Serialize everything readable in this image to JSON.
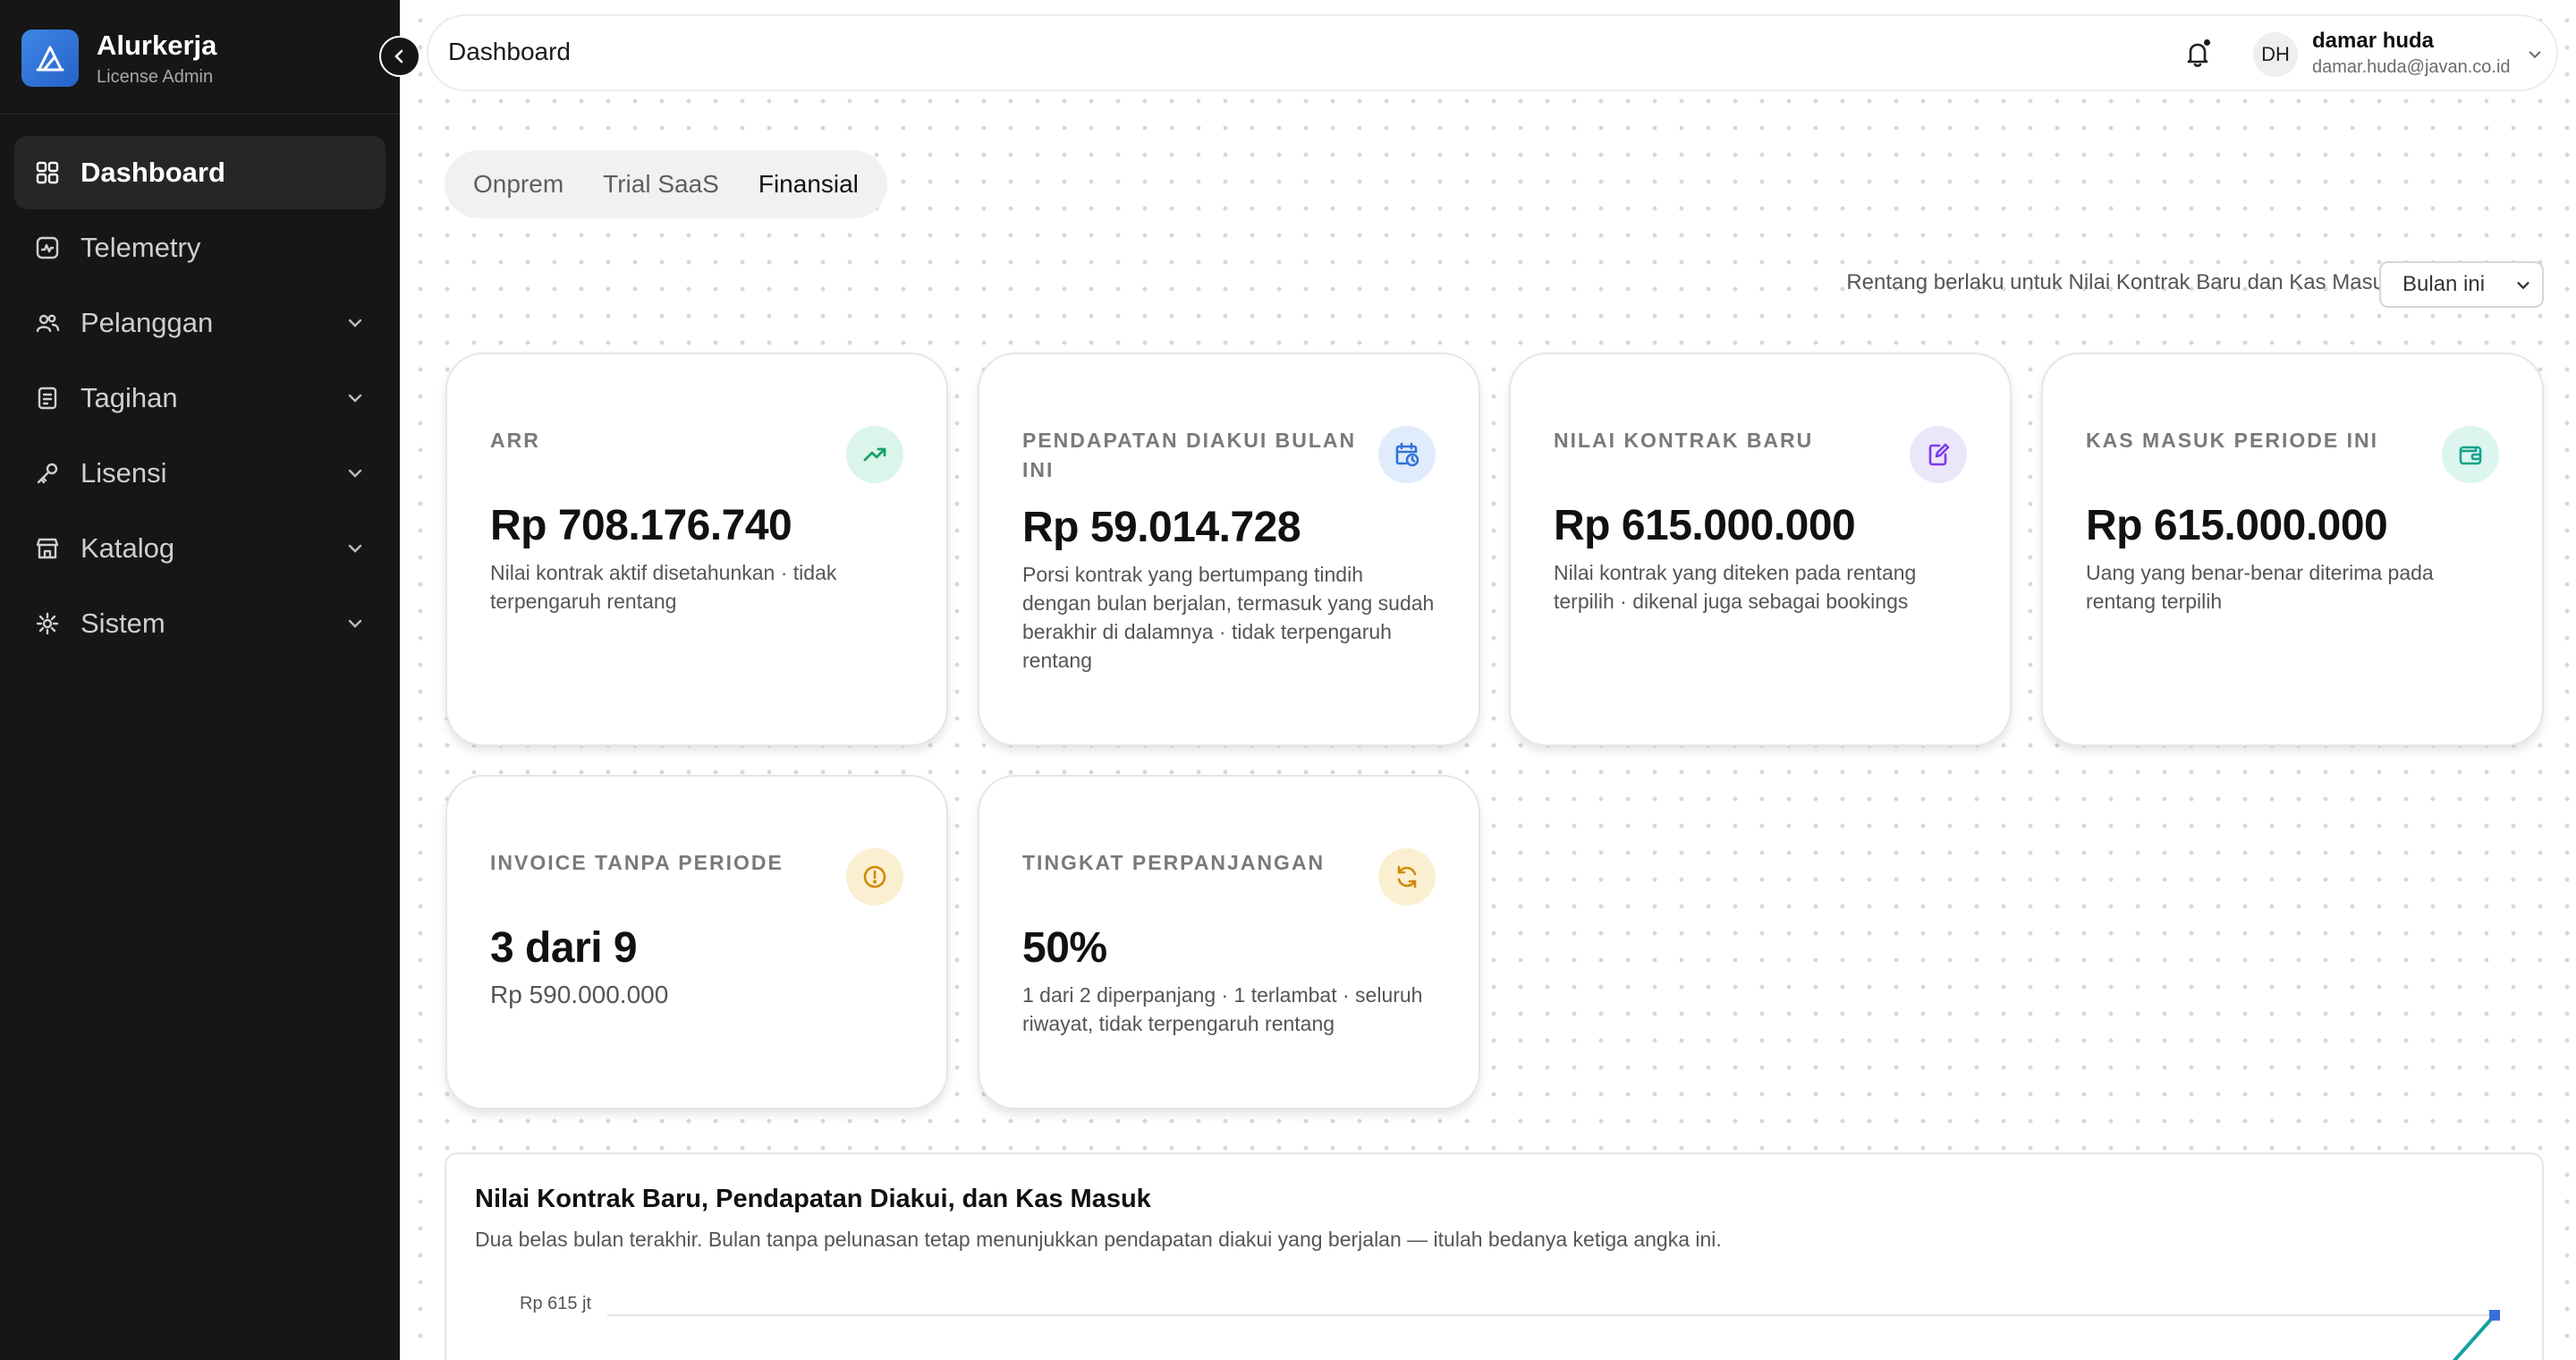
{
  "app": {
    "brand_name": "Alurkerja",
    "brand_sub": "License Admin",
    "brand_color": "#2f74d8"
  },
  "sidebar": {
    "items": [
      {
        "label": "Dashboard",
        "icon": "dashboard-grid-icon",
        "active": true,
        "expandable": false
      },
      {
        "label": "Telemetry",
        "icon": "activity-icon",
        "active": false,
        "expandable": false
      },
      {
        "label": "Pelanggan",
        "icon": "users-icon",
        "active": false,
        "expandable": true
      },
      {
        "label": "Tagihan",
        "icon": "receipt-icon",
        "active": false,
        "expandable": true
      },
      {
        "label": "Lisensi",
        "icon": "key-icon",
        "active": false,
        "expandable": true
      },
      {
        "label": "Katalog",
        "icon": "store-icon",
        "active": false,
        "expandable": true
      },
      {
        "label": "Sistem",
        "icon": "cog-icon",
        "active": false,
        "expandable": true
      }
    ]
  },
  "header": {
    "title": "Dashboard",
    "user": {
      "initials": "DH",
      "name": "damar huda",
      "email": "damar.huda@javan.co.id"
    }
  },
  "tabs": [
    {
      "label": "Onprem",
      "active": false
    },
    {
      "label": "Trial SaaS",
      "active": false
    },
    {
      "label": "Finansial",
      "active": true
    }
  ],
  "range": {
    "label": "Rentang berlaku untuk Nilai Kontrak Baru dan Kas Masuk",
    "selected": "Bulan ini"
  },
  "cards": [
    {
      "label": "ARR",
      "value": "Rp 708.176.740",
      "desc": "Nilai kontrak aktif disetahunkan · tidak terpengaruh rentang",
      "icon": "trending-up-icon",
      "icon_bg": "#dcf5ea",
      "icon_color": "#16a36a"
    },
    {
      "label": "PENDAPATAN DIAKUI BULAN INI",
      "value": "Rp 59.014.728",
      "desc": "Porsi kontrak yang bertumpang tindih dengan bulan berjalan, termasuk yang sudah berakhir di dalamnya · tidak terpengaruh rentang",
      "icon": "calendar-clock-icon",
      "icon_bg": "#e0ecfb",
      "icon_color": "#2f74d8"
    },
    {
      "label": "NILAI KONTRAK BARU",
      "value": "Rp 615.000.000",
      "desc": "Nilai kontrak yang diteken pada rentang terpilih · dikenal juga sebagai bookings",
      "icon": "file-edit-icon",
      "icon_bg": "#ece6fb",
      "icon_color": "#7c3aed"
    },
    {
      "label": "KAS MASUK PERIODE INI",
      "value": "Rp 615.000.000",
      "desc": "Uang yang benar-benar diterima pada rentang terpilih",
      "icon": "wallet-icon",
      "icon_bg": "#dcf5ef",
      "icon_color": "#14a38b"
    },
    {
      "label": "INVOICE TANPA PERIODE",
      "value": "3 dari 9",
      "sub": "Rp 590.000.000",
      "icon": "alert-circle-icon",
      "icon_bg": "#fbefd1",
      "icon_color": "#d08a06"
    },
    {
      "label": "TINGKAT PERPANJANGAN",
      "value": "50%",
      "desc": "1 dari 2 diperpanjang · 1 terlambat · seluruh riwayat, tidak terpengaruh rentang",
      "icon": "refresh-icon",
      "icon_bg": "#fbefd1",
      "icon_color": "#d08a06"
    }
  ],
  "chart": {
    "title": "Nilai Kontrak Baru, Pendapatan Diakui, dan Kas Masuk",
    "subtitle": "Dua belas bulan terakhir. Bulan tanpa pelunasan tetap menunjukkan pendapatan diakui yang berjalan — itulah bedanya ketiga angka ini.",
    "top_tick": "Rp 615 jt",
    "series_color": "#14a3a0",
    "point_color": "#3b6fd8"
  },
  "chart_data": {
    "type": "line",
    "title": "Nilai Kontrak Baru, Pendapatan Diakui, dan Kas Masuk",
    "ylabel": "",
    "y_ticks": [
      "Rp 615 jt"
    ],
    "series": [
      {
        "values": [
          615
        ]
      }
    ],
    "grid": true
  }
}
